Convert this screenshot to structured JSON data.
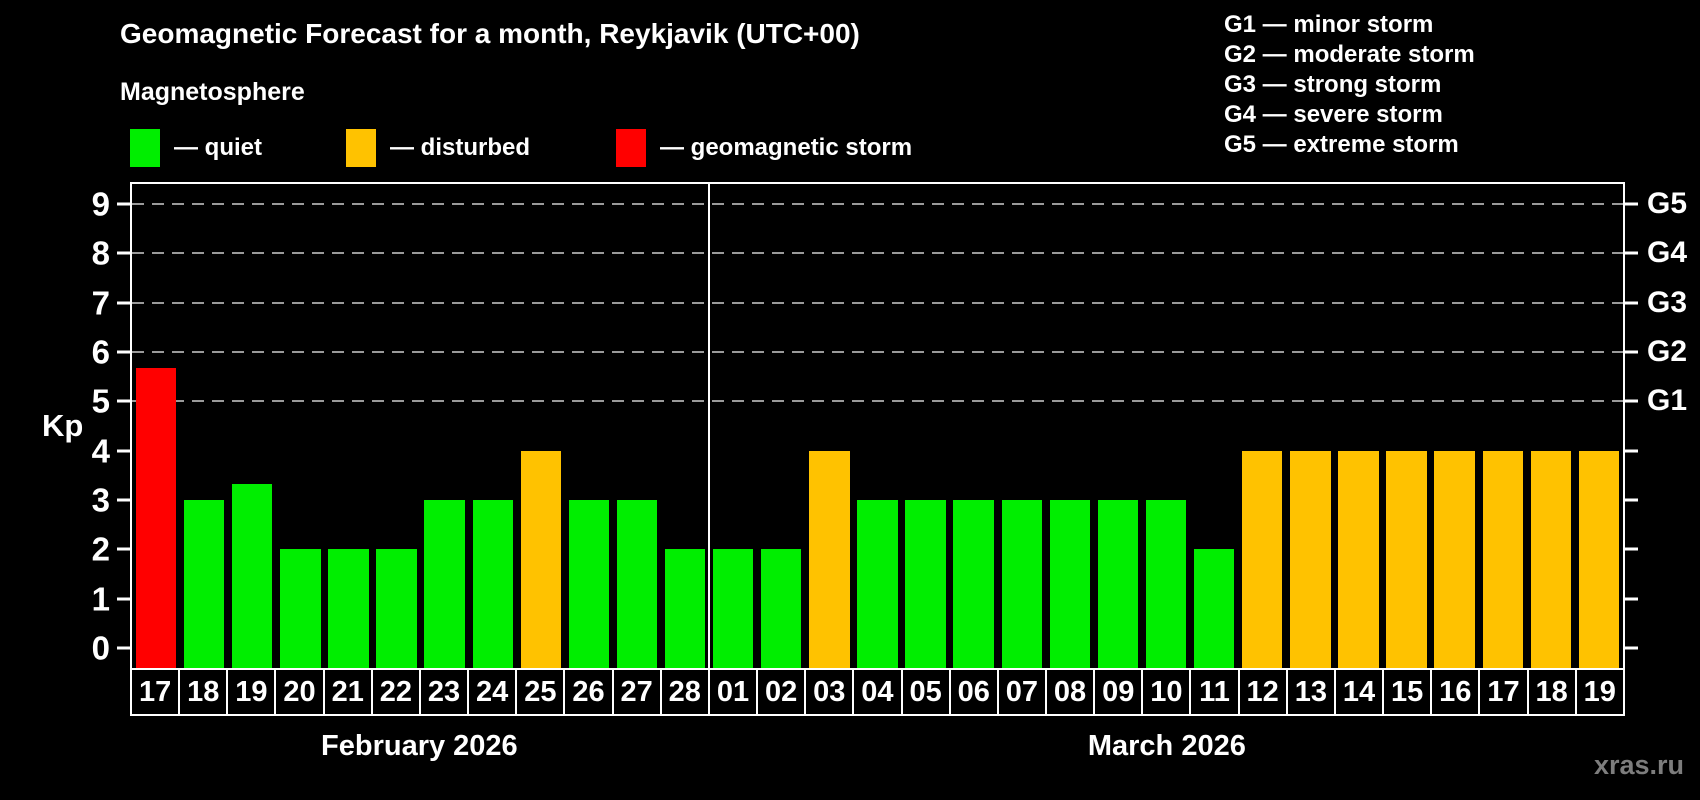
{
  "header": {
    "title": "Geomagnetic Forecast for a month, Reykjavik (UTC+00)",
    "subtitle": "Magnetosphere"
  },
  "legend": {
    "items": [
      {
        "key": "quiet",
        "label": "— quiet",
        "color": "#00ee00"
      },
      {
        "key": "disturbed",
        "label": "— disturbed",
        "color": "#ffc200"
      },
      {
        "key": "storm",
        "label": "— geomagnetic storm",
        "color": "#ff0000"
      }
    ]
  },
  "g_scale_legend": [
    "G1 — minor storm",
    "G2 — moderate storm",
    "G3 — strong storm",
    "G4 — severe storm",
    "G5 — extreme storm"
  ],
  "watermark": "xras.ru",
  "chart_data": {
    "type": "bar",
    "title": "Geomagnetic Forecast for a month, Reykjavik (UTC+00)",
    "xlabel": "",
    "ylabel": "Kp",
    "ylim": [
      -0.4,
      9.4
    ],
    "yticks": [
      0,
      1,
      2,
      3,
      4,
      5,
      6,
      7,
      8,
      9
    ],
    "gridlines_kp": [
      5,
      6,
      7,
      8,
      9
    ],
    "grid": "dashed horizontal at storm levels only",
    "legend_position": "top",
    "right_axis_labels": [
      {
        "kp": 5,
        "label": "G1"
      },
      {
        "kp": 6,
        "label": "G2"
      },
      {
        "kp": 7,
        "label": "G3"
      },
      {
        "kp": 8,
        "label": "G4"
      },
      {
        "kp": 9,
        "label": "G5"
      }
    ],
    "months": [
      {
        "label": "February 2026",
        "days": 12
      },
      {
        "label": "March 2026",
        "days": 19
      }
    ],
    "colors": {
      "quiet": "#00ee00",
      "disturbed": "#ffc200",
      "storm": "#ff0000"
    },
    "points": [
      {
        "day": "17",
        "value": 5.67,
        "status": "storm"
      },
      {
        "day": "18",
        "value": 3,
        "status": "quiet"
      },
      {
        "day": "19",
        "value": 3.33,
        "status": "quiet"
      },
      {
        "day": "20",
        "value": 2,
        "status": "quiet"
      },
      {
        "day": "21",
        "value": 2,
        "status": "quiet"
      },
      {
        "day": "22",
        "value": 2,
        "status": "quiet"
      },
      {
        "day": "23",
        "value": 3,
        "status": "quiet"
      },
      {
        "day": "24",
        "value": 3,
        "status": "quiet"
      },
      {
        "day": "25",
        "value": 4,
        "status": "disturbed"
      },
      {
        "day": "26",
        "value": 3,
        "status": "quiet"
      },
      {
        "day": "27",
        "value": 3,
        "status": "quiet"
      },
      {
        "day": "28",
        "value": 2,
        "status": "quiet"
      },
      {
        "day": "01",
        "value": 2,
        "status": "quiet"
      },
      {
        "day": "02",
        "value": 2,
        "status": "quiet"
      },
      {
        "day": "03",
        "value": 4,
        "status": "disturbed"
      },
      {
        "day": "04",
        "value": 3,
        "status": "quiet"
      },
      {
        "day": "05",
        "value": 3,
        "status": "quiet"
      },
      {
        "day": "06",
        "value": 3,
        "status": "quiet"
      },
      {
        "day": "07",
        "value": 3,
        "status": "quiet"
      },
      {
        "day": "08",
        "value": 3,
        "status": "quiet"
      },
      {
        "day": "09",
        "value": 3,
        "status": "quiet"
      },
      {
        "day": "10",
        "value": 3,
        "status": "quiet"
      },
      {
        "day": "11",
        "value": 2,
        "status": "quiet"
      },
      {
        "day": "12",
        "value": 4,
        "status": "disturbed"
      },
      {
        "day": "13",
        "value": 4,
        "status": "disturbed"
      },
      {
        "day": "14",
        "value": 4,
        "status": "disturbed"
      },
      {
        "day": "15",
        "value": 4,
        "status": "disturbed"
      },
      {
        "day": "16",
        "value": 4,
        "status": "disturbed"
      },
      {
        "day": "17",
        "value": 4,
        "status": "disturbed"
      },
      {
        "day": "18",
        "value": 4,
        "status": "disturbed"
      },
      {
        "day": "19",
        "value": 4,
        "status": "disturbed"
      }
    ]
  }
}
